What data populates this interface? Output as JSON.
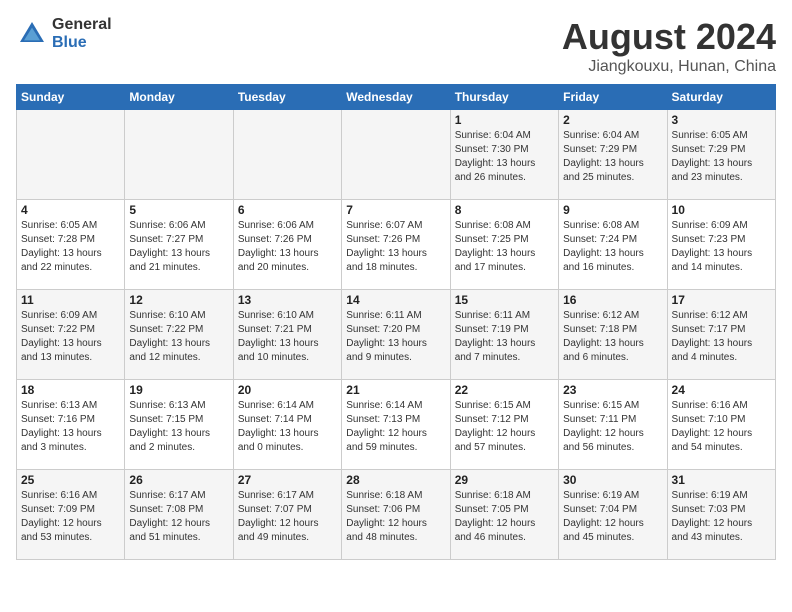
{
  "header": {
    "logo_general": "General",
    "logo_blue": "Blue",
    "month_title": "August 2024",
    "subtitle": "Jiangkouxu, Hunan, China"
  },
  "days_of_week": [
    "Sunday",
    "Monday",
    "Tuesday",
    "Wednesday",
    "Thursday",
    "Friday",
    "Saturday"
  ],
  "weeks": [
    [
      {
        "day": "",
        "info": ""
      },
      {
        "day": "",
        "info": ""
      },
      {
        "day": "",
        "info": ""
      },
      {
        "day": "",
        "info": ""
      },
      {
        "day": "1",
        "info": "Sunrise: 6:04 AM\nSunset: 7:30 PM\nDaylight: 13 hours\nand 26 minutes."
      },
      {
        "day": "2",
        "info": "Sunrise: 6:04 AM\nSunset: 7:29 PM\nDaylight: 13 hours\nand 25 minutes."
      },
      {
        "day": "3",
        "info": "Sunrise: 6:05 AM\nSunset: 7:29 PM\nDaylight: 13 hours\nand 23 minutes."
      }
    ],
    [
      {
        "day": "4",
        "info": "Sunrise: 6:05 AM\nSunset: 7:28 PM\nDaylight: 13 hours\nand 22 minutes."
      },
      {
        "day": "5",
        "info": "Sunrise: 6:06 AM\nSunset: 7:27 PM\nDaylight: 13 hours\nand 21 minutes."
      },
      {
        "day": "6",
        "info": "Sunrise: 6:06 AM\nSunset: 7:26 PM\nDaylight: 13 hours\nand 20 minutes."
      },
      {
        "day": "7",
        "info": "Sunrise: 6:07 AM\nSunset: 7:26 PM\nDaylight: 13 hours\nand 18 minutes."
      },
      {
        "day": "8",
        "info": "Sunrise: 6:08 AM\nSunset: 7:25 PM\nDaylight: 13 hours\nand 17 minutes."
      },
      {
        "day": "9",
        "info": "Sunrise: 6:08 AM\nSunset: 7:24 PM\nDaylight: 13 hours\nand 16 minutes."
      },
      {
        "day": "10",
        "info": "Sunrise: 6:09 AM\nSunset: 7:23 PM\nDaylight: 13 hours\nand 14 minutes."
      }
    ],
    [
      {
        "day": "11",
        "info": "Sunrise: 6:09 AM\nSunset: 7:22 PM\nDaylight: 13 hours\nand 13 minutes."
      },
      {
        "day": "12",
        "info": "Sunrise: 6:10 AM\nSunset: 7:22 PM\nDaylight: 13 hours\nand 12 minutes."
      },
      {
        "day": "13",
        "info": "Sunrise: 6:10 AM\nSunset: 7:21 PM\nDaylight: 13 hours\nand 10 minutes."
      },
      {
        "day": "14",
        "info": "Sunrise: 6:11 AM\nSunset: 7:20 PM\nDaylight: 13 hours\nand 9 minutes."
      },
      {
        "day": "15",
        "info": "Sunrise: 6:11 AM\nSunset: 7:19 PM\nDaylight: 13 hours\nand 7 minutes."
      },
      {
        "day": "16",
        "info": "Sunrise: 6:12 AM\nSunset: 7:18 PM\nDaylight: 13 hours\nand 6 minutes."
      },
      {
        "day": "17",
        "info": "Sunrise: 6:12 AM\nSunset: 7:17 PM\nDaylight: 13 hours\nand 4 minutes."
      }
    ],
    [
      {
        "day": "18",
        "info": "Sunrise: 6:13 AM\nSunset: 7:16 PM\nDaylight: 13 hours\nand 3 minutes."
      },
      {
        "day": "19",
        "info": "Sunrise: 6:13 AM\nSunset: 7:15 PM\nDaylight: 13 hours\nand 2 minutes."
      },
      {
        "day": "20",
        "info": "Sunrise: 6:14 AM\nSunset: 7:14 PM\nDaylight: 13 hours\nand 0 minutes."
      },
      {
        "day": "21",
        "info": "Sunrise: 6:14 AM\nSunset: 7:13 PM\nDaylight: 12 hours\nand 59 minutes."
      },
      {
        "day": "22",
        "info": "Sunrise: 6:15 AM\nSunset: 7:12 PM\nDaylight: 12 hours\nand 57 minutes."
      },
      {
        "day": "23",
        "info": "Sunrise: 6:15 AM\nSunset: 7:11 PM\nDaylight: 12 hours\nand 56 minutes."
      },
      {
        "day": "24",
        "info": "Sunrise: 6:16 AM\nSunset: 7:10 PM\nDaylight: 12 hours\nand 54 minutes."
      }
    ],
    [
      {
        "day": "25",
        "info": "Sunrise: 6:16 AM\nSunset: 7:09 PM\nDaylight: 12 hours\nand 53 minutes."
      },
      {
        "day": "26",
        "info": "Sunrise: 6:17 AM\nSunset: 7:08 PM\nDaylight: 12 hours\nand 51 minutes."
      },
      {
        "day": "27",
        "info": "Sunrise: 6:17 AM\nSunset: 7:07 PM\nDaylight: 12 hours\nand 49 minutes."
      },
      {
        "day": "28",
        "info": "Sunrise: 6:18 AM\nSunset: 7:06 PM\nDaylight: 12 hours\nand 48 minutes."
      },
      {
        "day": "29",
        "info": "Sunrise: 6:18 AM\nSunset: 7:05 PM\nDaylight: 12 hours\nand 46 minutes."
      },
      {
        "day": "30",
        "info": "Sunrise: 6:19 AM\nSunset: 7:04 PM\nDaylight: 12 hours\nand 45 minutes."
      },
      {
        "day": "31",
        "info": "Sunrise: 6:19 AM\nSunset: 7:03 PM\nDaylight: 12 hours\nand 43 minutes."
      }
    ]
  ]
}
